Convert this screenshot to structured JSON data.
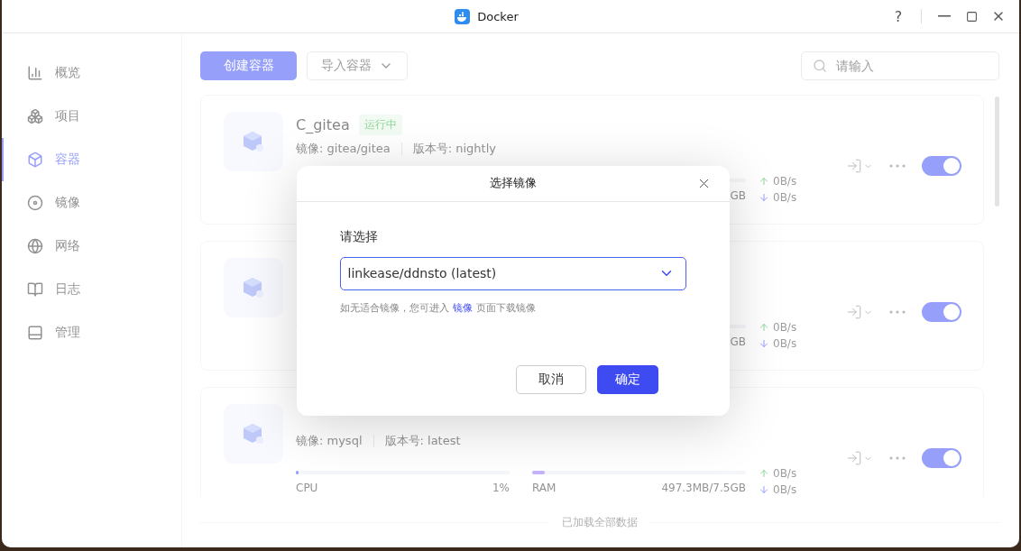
{
  "window": {
    "title": "Docker",
    "help": "?"
  },
  "sidebar": {
    "items": [
      {
        "label": "概览",
        "selected": false
      },
      {
        "label": "项目",
        "selected": false
      },
      {
        "label": "容器",
        "selected": true
      },
      {
        "label": "镜像",
        "selected": false
      },
      {
        "label": "网络",
        "selected": false
      },
      {
        "label": "日志",
        "selected": false
      },
      {
        "label": "管理",
        "selected": false
      }
    ]
  },
  "toolbar": {
    "create_button": "创建容器",
    "import_button": "导入容器",
    "search": {
      "placeholder": "请输入"
    }
  },
  "containers": [
    {
      "name": "C_gitea",
      "status": "运行中",
      "image": "镜像: gitea/gitea",
      "version": "版本号: nightly",
      "ram": {
        "value": "GB"
      },
      "net_up": "0B/s",
      "net_down": "0B/s",
      "on": true
    },
    {
      "ram": {
        "value": "GB"
      },
      "net_up": "0B/s",
      "net_down": "0B/s",
      "on": true
    },
    {
      "image": "镜像: mysql",
      "version": "版本号: latest",
      "cpu": {
        "label": "CPU",
        "value": "1%",
        "level": 0.01
      },
      "ram": {
        "label": "RAM",
        "value": "497.3MB/7.5GB",
        "level": 0.06
      },
      "net_up": "0B/s",
      "net_down": "0B/s",
      "on": true
    }
  ],
  "footer": "已加载全部数据",
  "dialog": {
    "title": "选择镜像",
    "label": "请选择",
    "value": "linkease/ddnsto (latest)",
    "hint_before": "如无适合镜像，您可进入",
    "hint_link": "镜像",
    "hint_after": "页面下载镜像",
    "cancel": "取消",
    "confirm": "确定"
  }
}
